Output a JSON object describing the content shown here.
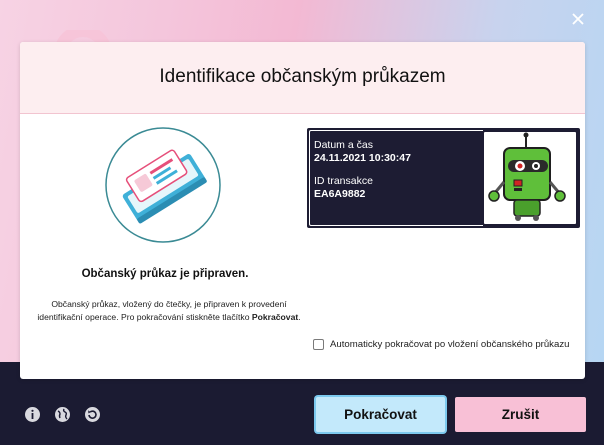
{
  "window": {
    "close_icon": "close-icon",
    "title": "Identifikace občanským průkazem"
  },
  "status": {
    "title": "Občanský průkaz je připraven.",
    "description_part1": "Občanský průkaz, vložený do čtečky, je připraven k provedení identifikační operace. Pro pokračování stiskněte tlačítko ",
    "description_bold": "Pokračovat",
    "description_end": "."
  },
  "transaction": {
    "datetime_label": "Datum a čas",
    "datetime_value": "24.11.2021 10:30:47",
    "id_label": "ID transakce",
    "id_value": "EA6A9882"
  },
  "auto_continue": {
    "label": "Automaticky pokračovat po vložení občanského průkazu",
    "checked": false
  },
  "footer": {
    "icons": [
      "info-icon",
      "globe-icon",
      "refresh-icon"
    ],
    "continue_label": "Pokračovat",
    "cancel_label": "Zrušit"
  },
  "colors": {
    "dark_bg": "#1b1b32",
    "header_bg": "#fdeef0",
    "continue_bg": "#c3e9fb",
    "cancel_bg": "#f8c0d6",
    "robot_green": "#5fbf3a"
  }
}
